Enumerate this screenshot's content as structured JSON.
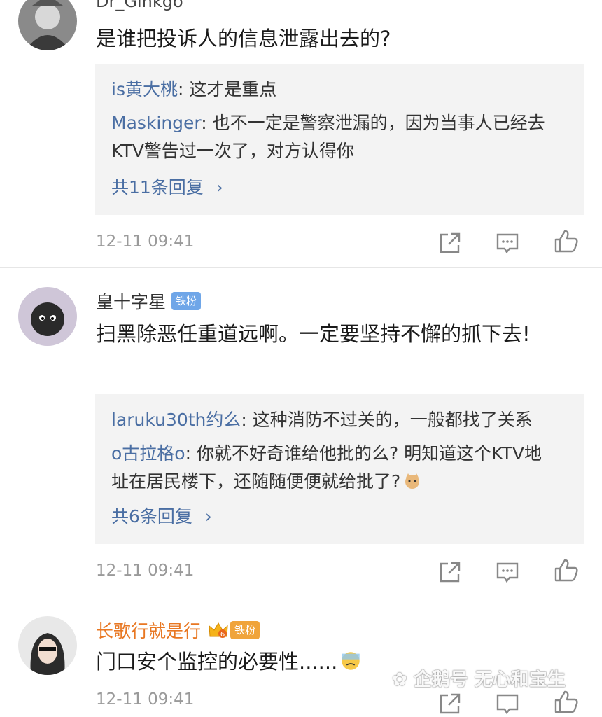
{
  "comments": [
    {
      "username": "Dr_Ginkgo",
      "text": "是谁把投诉人的信息泄露出去的?",
      "replies": [
        {
          "user": "is黄大桃",
          "text": ": 这才是重点"
        },
        {
          "user": "Maskinger",
          "text": ": 也不一定是警察泄漏的，因为当事人已经去KTV警告过一次了，对方认得你"
        }
      ],
      "more": "共11条回复",
      "time": "12-11 09:41"
    },
    {
      "username": "皇十字星",
      "badge": "铁粉",
      "text": "扫黑除恶任重道远啊。一定要坚持不懈的抓下去!",
      "replies": [
        {
          "user": "laruku30th约么",
          "text": ": 这种消防不过关的，一般都找了关系"
        },
        {
          "user": "o古拉格o",
          "text": ": 你就不好奇谁给他批的么? 明知道这个KTV地址在居民楼下，还随随便便就给批了?"
        }
      ],
      "more": "共6条回复",
      "time": "12-11 09:41"
    },
    {
      "username": "长歌行就是行",
      "badge": "铁粉",
      "crown_level": "6",
      "text": "门口安个监控的必要性......",
      "time": "12-11 09:41"
    }
  ],
  "watermark": "企鹅号 无心和宝生",
  "icons": [
    "share-icon",
    "comment-icon",
    "like-icon"
  ],
  "colors": {
    "link": "#4a6ea3",
    "badge": "#6fa6e8",
    "vip": "#e87722",
    "time": "#9a9a9a"
  }
}
